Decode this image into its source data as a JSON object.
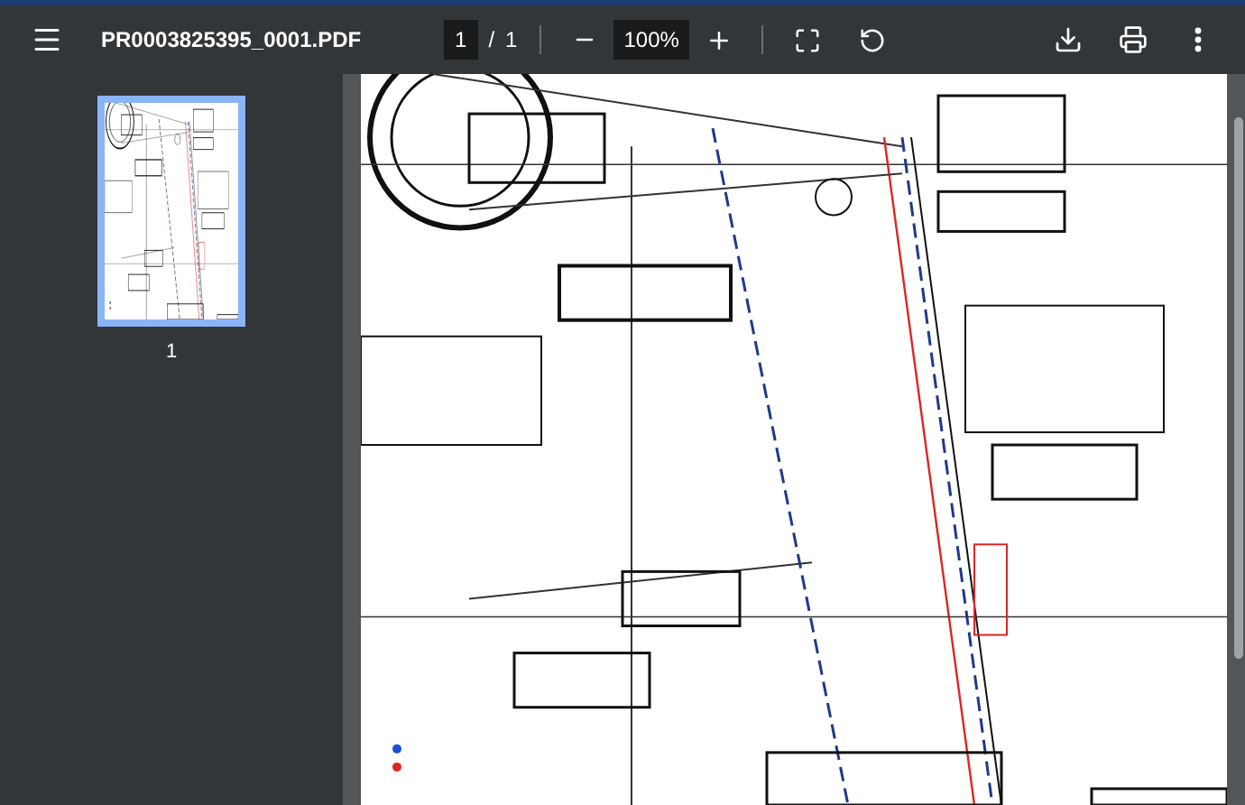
{
  "toolbar": {
    "title": "PR0003825395_0001.PDF",
    "page_input": "1",
    "page_separator": "/",
    "page_total": "1",
    "zoom": "100%"
  },
  "thumbnails": [
    {
      "label": "1",
      "selected": true
    }
  ]
}
